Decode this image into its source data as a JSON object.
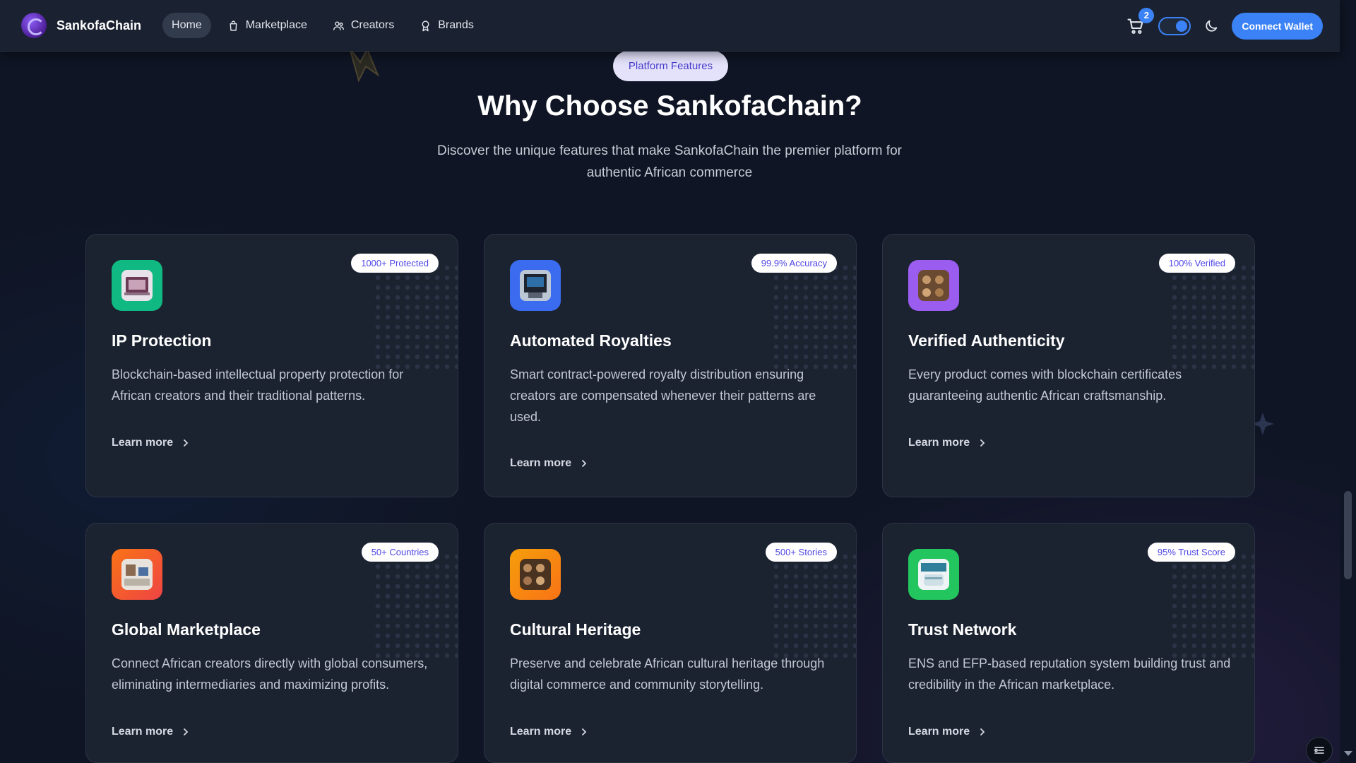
{
  "nav": {
    "brand": "SankofaChain",
    "links": [
      {
        "label": "Home",
        "icon": "none",
        "active": true
      },
      {
        "label": "Marketplace",
        "icon": "shopping-bag-icon",
        "active": false
      },
      {
        "label": "Creators",
        "icon": "users-icon",
        "active": false
      },
      {
        "label": "Brands",
        "icon": "award-icon",
        "active": false
      }
    ],
    "cart_count": "2",
    "connect_label": "Connect Wallet"
  },
  "hero": {
    "pill": "Platform Features",
    "title": "Why Choose SankofaChain?",
    "subtitle": "Discover the unique features that make SankofaChain the premier platform for authentic African commerce"
  },
  "cards": [
    {
      "title": "IP Protection",
      "badge": "1000+ Protected",
      "desc": "Blockchain-based intellectual property protection for African creators and their traditional patterns.",
      "cta": "Learn more",
      "color": "#10b981"
    },
    {
      "title": "Automated Royalties",
      "badge": "99.9% Accuracy",
      "desc": "Smart contract-powered royalty distribution ensuring creators are compensated whenever their patterns are used.",
      "cta": "Learn more",
      "color": "#3b6cf0"
    },
    {
      "title": "Verified Authenticity",
      "badge": "100% Verified",
      "desc": "Every product comes with blockchain certificates guaranteeing authentic African craftsmanship.",
      "cta": "Learn more",
      "color": "#9b5cf0"
    },
    {
      "title": "Global Marketplace",
      "badge": "50+ Countries",
      "desc": "Connect African creators directly with global consumers, eliminating intermediaries and maximizing profits.",
      "cta": "Learn more",
      "color": "#f05a2a"
    },
    {
      "title": "Cultural Heritage",
      "badge": "500+ Stories",
      "desc": "Preserve and celebrate African cultural heritage through digital commerce and community storytelling.",
      "cta": "Learn more",
      "color": "#f59e0b"
    },
    {
      "title": "Trust Network",
      "badge": "95% Trust Score",
      "desc": "ENS and EFP-based reputation system building trust and credibility in the African marketplace.",
      "cta": "Learn more",
      "color": "#22c55e"
    }
  ]
}
